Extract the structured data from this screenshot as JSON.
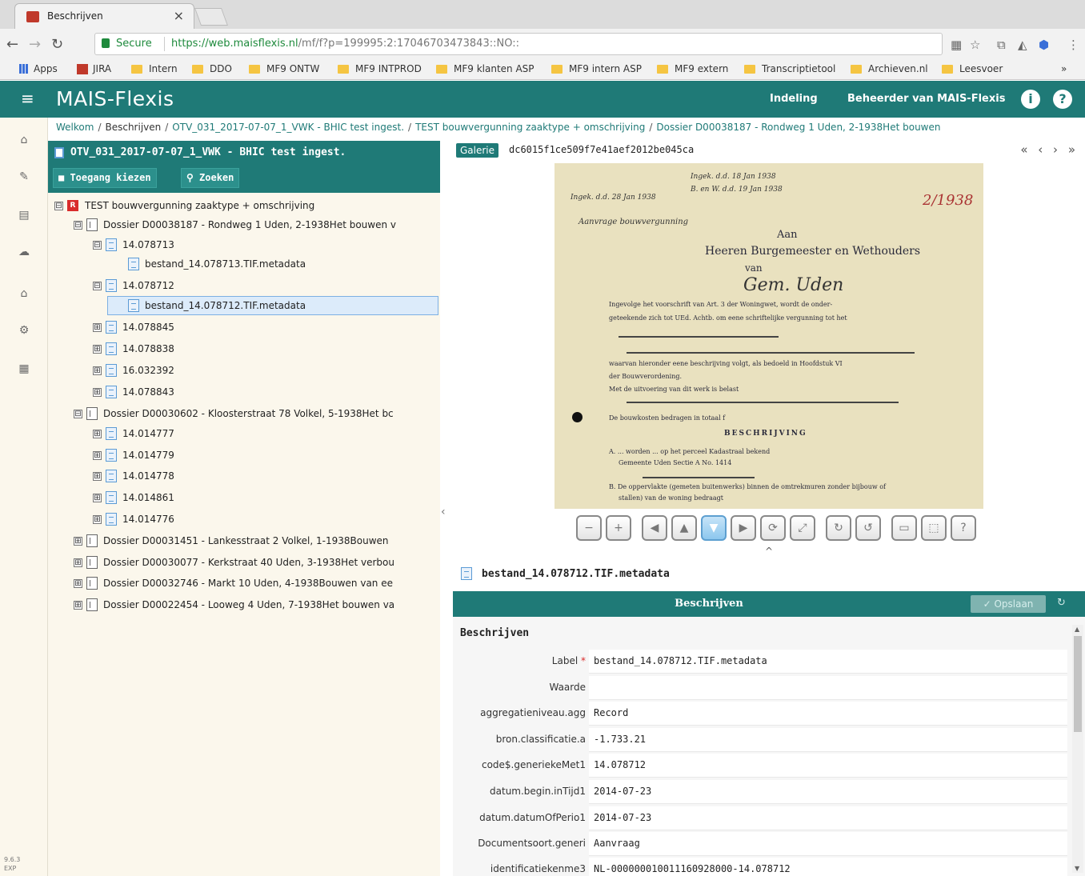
{
  "browser": {
    "tab_title": "Beschrijven",
    "tab_close": "×",
    "secure_label": "Secure",
    "url_host": "https://web.maisflexis.nl",
    "url_path": "/mf/f?p=199995:2:17046703473843::NO::",
    "bookmarks": [
      "Apps",
      "JIRA",
      "Intern",
      "DDO",
      "MF9 ONTW",
      "MF9 INTPROD",
      "MF9 klanten ASP",
      "MF9 intern ASP",
      "MF9 extern",
      "Transcriptietool",
      "Archieven.nl",
      "Leesvoer"
    ],
    "more": "»"
  },
  "header": {
    "title": "MAIS-Flexis",
    "indeling": "Indeling",
    "beheerder": "Beheerder van MAIS-Flexis",
    "info_icon": "info-icon",
    "help_icon": "help-icon"
  },
  "sidebar": {
    "icons": [
      "home-icon",
      "edit-icon",
      "list-icon",
      "cloud-icon",
      "bank-icon",
      "settings-icon",
      "grid-icon"
    ],
    "version": "9.6.3",
    "env": "EXP"
  },
  "breadcrumb": [
    "Welkom",
    "Beschrijven",
    "OTV_031_2017-07-07_1_VWK - BHIC test ingest.",
    "TEST bouwvergunning zaaktype + omschrijving",
    "Dossier D00038187 - Rondweg 1 Uden, 2-1938Het bouwen"
  ],
  "tree": {
    "title": "OTV_031_2017-07-07_1_VWK - BHIC test ingest.",
    "btn_toegang": "Toegang kiezen",
    "btn_zoeken": "Zoeken",
    "nodes": [
      {
        "label": "TEST bouwvergunning zaaktype + omschrijving",
        "toggle": "⊟"
      },
      {
        "label": "Dossier D00038187 - Rondweg 1 Uden, 2-1938Het bouwen v",
        "toggle": "⊟"
      },
      {
        "label": "14.078713",
        "toggle": "⊟"
      },
      {
        "label": "bestand_14.078713.TIF.metadata",
        "toggle": ""
      },
      {
        "label": "14.078712",
        "toggle": "⊟"
      },
      {
        "label": "bestand_14.078712.TIF.metadata",
        "toggle": ""
      },
      {
        "label": "14.078845",
        "toggle": "⊞"
      },
      {
        "label": "14.078838",
        "toggle": "⊞"
      },
      {
        "label": "16.032392",
        "toggle": "⊞"
      },
      {
        "label": "14.078843",
        "toggle": "⊞"
      },
      {
        "label": "Dossier D00030602 - Kloosterstraat 78 Volkel, 5-1938Het bc",
        "toggle": "⊟"
      },
      {
        "label": "14.014777",
        "toggle": "⊞"
      },
      {
        "label": "14.014779",
        "toggle": "⊞"
      },
      {
        "label": "14.014778",
        "toggle": "⊞"
      },
      {
        "label": "14.014861",
        "toggle": "⊞"
      },
      {
        "label": "14.014776",
        "toggle": "⊞"
      },
      {
        "label": "Dossier D00031451 - Lankesstraat 2 Volkel, 1-1938Bouwen",
        "toggle": "⊞"
      },
      {
        "label": "Dossier D00030077 - Kerkstraat 40 Uden, 3-1938Het verbou",
        "toggle": "⊞"
      },
      {
        "label": "Dossier D00032746 - Markt 10 Uden, 4-1938Bouwen van ee",
        "toggle": "⊞"
      },
      {
        "label": "Dossier D00022454 - Looweg 4 Uden, 7-1938Het bouwen va",
        "toggle": "⊞"
      }
    ]
  },
  "viewer": {
    "gallery_label": "Galerie",
    "hash": "dc6015f1ce509f7e41aef2012be045ca",
    "nav": "« ‹ › »",
    "scan": {
      "line1": "Aan",
      "line2": "Heeren Burgemeester en Wethouders",
      "line3": "van",
      "line4": "Gem. Uden",
      "line5": "Ingevolge het voorschrift van Art. 3 der Woningwet, wordt de onder-",
      "line6": "geteekende zich tot UEd. Achtb. om eene schriftelijke vergunning tot het",
      "line7": "waarvan hieronder eene beschrijving volgt, als bedoeld in Hoofdstuk VI",
      "line8": "der Bouwverordening.",
      "line9": "Met de uitvoering van dit werk is belast",
      "line10": "De bouwkosten bedragen in totaal f",
      "line11": "BESCHRIJVING",
      "line12": "A. ... worden ... op het perceel Kadastraal bekend",
      "line13": "Gemeente Uden Sectie A No. 1414",
      "line14": "B. De oppervlakte (gemeten buitenwerks) binnen de omtrekmuren zonder bijbouw of",
      "line15": "stallen) van de woning bedraagt",
      "anno": "2/1938"
    }
  },
  "metadata": {
    "title": "bestand_14.078712.TIF.metadata",
    "bar_label": "Beschrijven",
    "save_label": "✓ Opslaan",
    "section": "Beschrijven",
    "fields": [
      {
        "label": "Label",
        "required": "*",
        "value": "bestand_14.078712.TIF.metadata"
      },
      {
        "label": "Waarde",
        "required": "",
        "value": ""
      },
      {
        "label": "aggregatieniveau.agg",
        "required": "",
        "value": "Record"
      },
      {
        "label": "bron.classificatie.a",
        "required": "",
        "value": "-1.733.21"
      },
      {
        "label": "code$.generiekeMet1",
        "required": "",
        "value": "14.078712"
      },
      {
        "label": "datum.begin.inTijd1",
        "required": "",
        "value": "2014-07-23"
      },
      {
        "label": "datum.datumOfPerio1",
        "required": "",
        "value": "2014-07-23"
      },
      {
        "label": "Documentsoort.generi",
        "required": "",
        "value": "Aanvraag"
      },
      {
        "label": "identificatiekenme3",
        "required": "",
        "value": "NL-000000010011160928000-14.078712"
      }
    ]
  },
  "colors": {
    "teal": "#1f7a77",
    "cream": "#fbf7ec",
    "selection": "#dcebfa"
  }
}
